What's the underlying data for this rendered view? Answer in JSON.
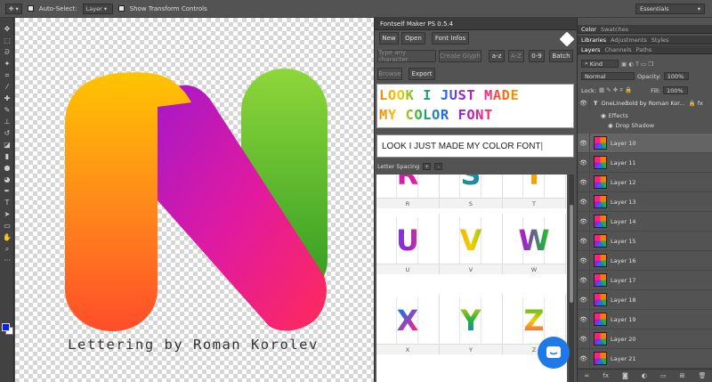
{
  "options_bar": {
    "auto_select_label": "Auto-Select:",
    "auto_select_value": "Layer",
    "transform_label": "Show Transform Controls",
    "workspace": "Essentials"
  },
  "canvas": {
    "caption": "Lettering by Roman Korolev"
  },
  "plugin": {
    "title": "Fontself Maker PS 0.5.4",
    "buttons": {
      "new": "New",
      "open": "Open",
      "font_infos": "Font Infos",
      "type_any": "Type any character",
      "create_glyph": "Create Glyph",
      "lower_az": "a-z",
      "upper_az": "A-Z",
      "digits": "0-9",
      "batch": "Batch",
      "browse": "Browse",
      "export": "Export"
    },
    "preview_lines": [
      "LOOK I JUST MADE",
      "MY COLOR FONT"
    ],
    "text_input": "LOOK I JUST MADE MY COLOR FONT",
    "letter_spacing_label": "Letter Spacing",
    "ls_plus": "+",
    "ls_minus": "-",
    "glyph_rows": [
      [
        "R",
        "S",
        "T"
      ],
      [
        "U",
        "V",
        "W"
      ],
      [
        "X",
        "Y",
        "Z"
      ]
    ]
  },
  "right_panel": {
    "tabs_top": [
      "Color",
      "Swatches"
    ],
    "tabs_mid": [
      "Libraries",
      "Adjustments",
      "Styles"
    ],
    "tabs_layers": [
      "Layers",
      "Channels",
      "Paths"
    ],
    "kind_label": "Kind",
    "blend_mode": "Normal",
    "opacity_label": "Opacity:",
    "opacity_value": "100%",
    "lock_label": "Lock:",
    "fill_label": "Fill:",
    "fill_value": "100%",
    "text_layer": "OneLineBold by Roman Kor...",
    "effects_label": "Effects",
    "drop_shadow_label": "Drop Shadow",
    "layers": [
      "Layer 10",
      "Layer 11",
      "Layer 12",
      "Layer 13",
      "Layer 14",
      "Layer 15",
      "Layer 16",
      "Layer 17",
      "Layer 18",
      "Layer 19",
      "Layer 20",
      "Layer 21"
    ]
  },
  "colors": {
    "foreground": "#0a1ef0",
    "background": "#ffffff",
    "chat_button": "#1f79e8"
  },
  "icons": [
    "move-icon",
    "marquee-icon",
    "lasso-icon",
    "magic-wand-icon",
    "crop-icon",
    "eyedropper-icon",
    "healing-icon",
    "brush-icon",
    "stamp-icon",
    "history-brush-icon",
    "eraser-icon",
    "gradient-icon",
    "blur-icon",
    "dodge-icon",
    "pen-icon",
    "type-icon",
    "path-select-icon",
    "shape-icon",
    "hand-icon",
    "zoom-icon",
    "chat-icon",
    "eye-icon"
  ]
}
